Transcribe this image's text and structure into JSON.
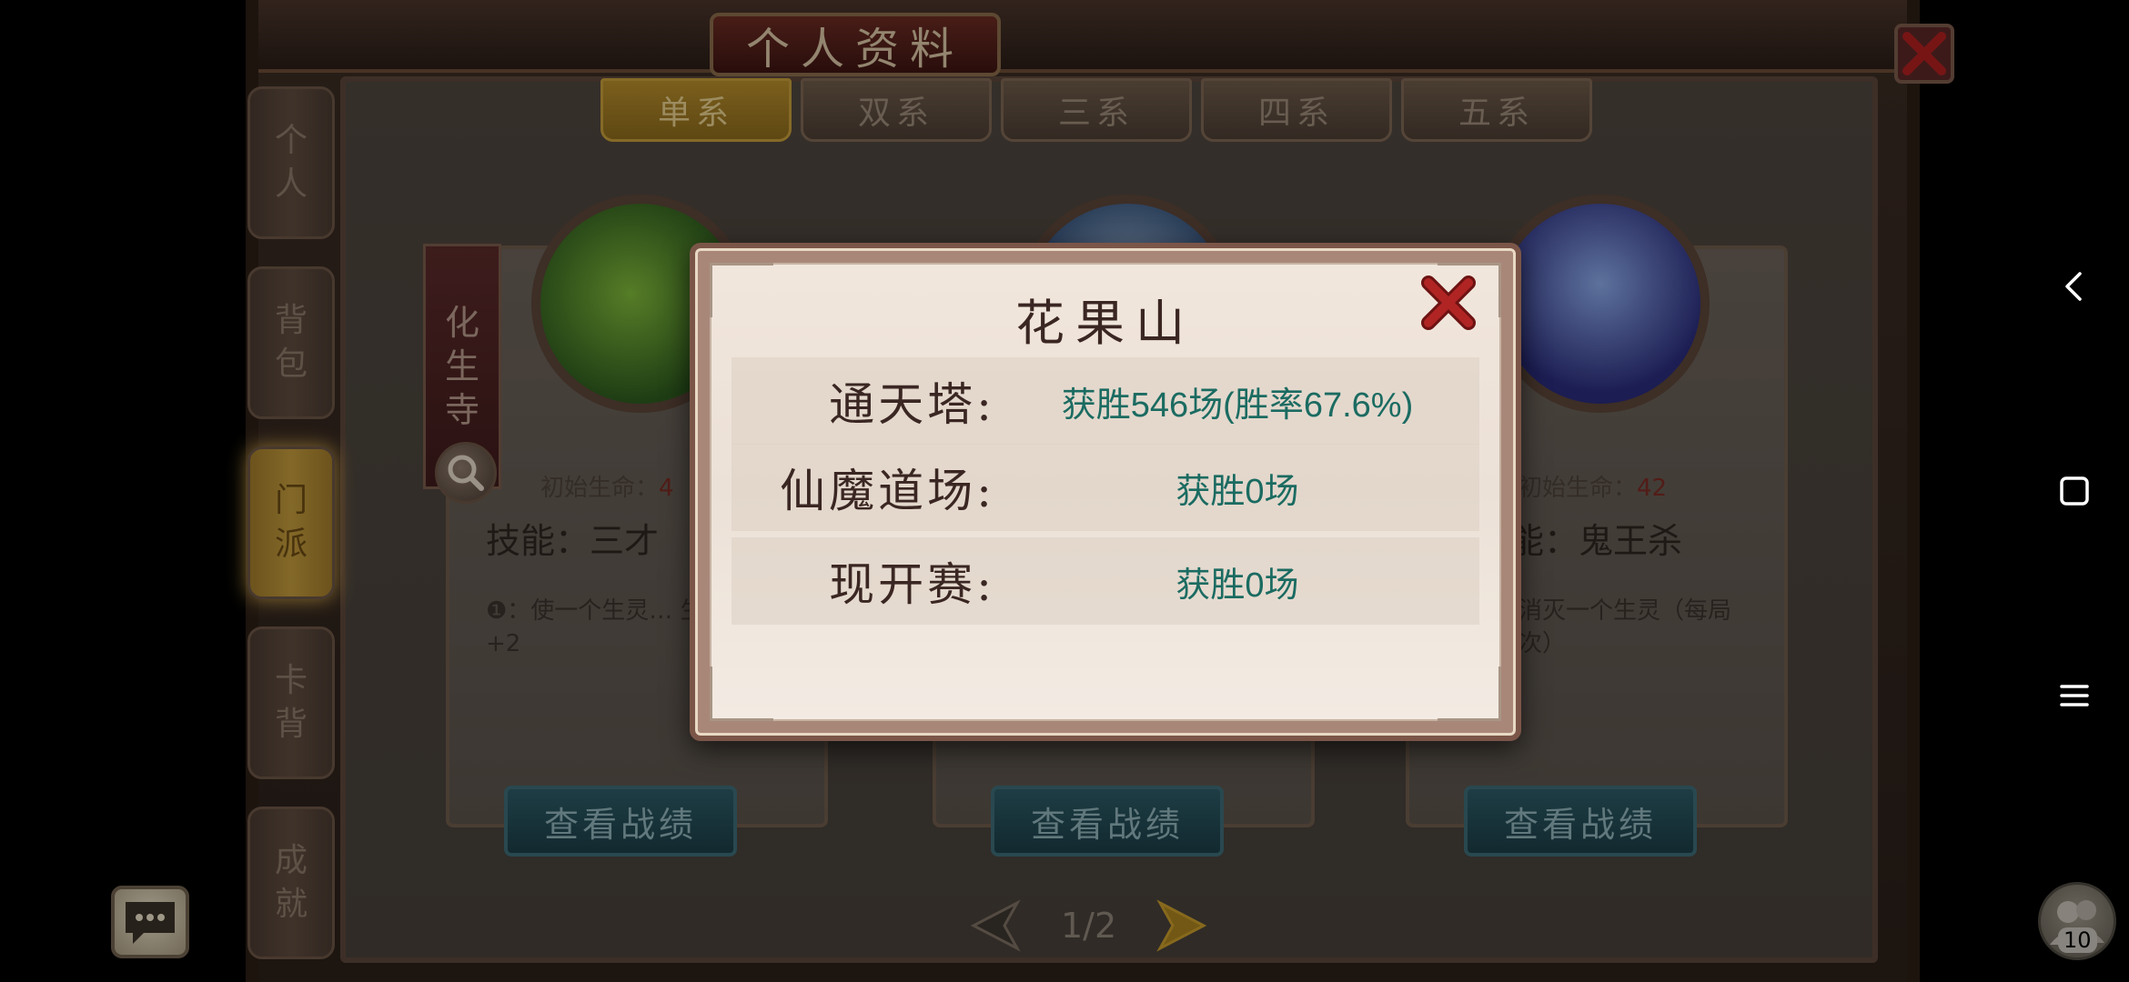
{
  "header": {
    "title": "个人资料"
  },
  "tabs": [
    {
      "label": "单系",
      "active": true
    },
    {
      "label": "双系",
      "active": false
    },
    {
      "label": "三系",
      "active": false
    },
    {
      "label": "四系",
      "active": false
    },
    {
      "label": "五系",
      "active": false
    }
  ],
  "sidenav": [
    {
      "label": "个人"
    },
    {
      "label": "背包"
    },
    {
      "label": "门派",
      "active": true
    },
    {
      "label": "卡背"
    },
    {
      "label": "成就"
    }
  ],
  "sect_ribbon": "化生寺",
  "cards": [
    {
      "init_life_label": "初始生命：",
      "init_life_value": "4",
      "skill": "技能：三才",
      "desc": "❶：使一个生灵… 生灵的生命+2",
      "view_button": "查看战绩"
    },
    {
      "init_life_label": "",
      "init_life_value": "",
      "skill": "",
      "desc": "",
      "view_button": "查看战绩"
    },
    {
      "init_life_label": "初始生命：",
      "init_life_value": "42",
      "skill": "能：鬼王杀",
      "desc": "消灭一个生灵（每局 次）",
      "view_button": "查看战绩"
    }
  ],
  "pager": {
    "label": "1/2"
  },
  "friends": {
    "count": "10"
  },
  "modal": {
    "title": "花果山",
    "rows": [
      {
        "label": "通天塔:",
        "value": "获胜546场(胜率67.6%)"
      },
      {
        "label": "仙魔道场:",
        "value": "获胜0场"
      },
      {
        "label": "现开赛:",
        "value": "获胜0场"
      }
    ]
  },
  "colors": {
    "stat_value": "#1b6b61",
    "modal_title": "#3a2622",
    "close_red": "#9b1c1c"
  },
  "icons": {
    "modal_close": "close-icon",
    "bg_close": "close-icon",
    "chat": "chat-bubble-icon",
    "friends": "friends-icon",
    "search": "search-icon",
    "pager_prev": "arrow-left-icon",
    "pager_next": "arrow-right-icon",
    "sys_back": "back-icon",
    "sys_home": "square-icon",
    "sys_menu": "menu-icon"
  }
}
